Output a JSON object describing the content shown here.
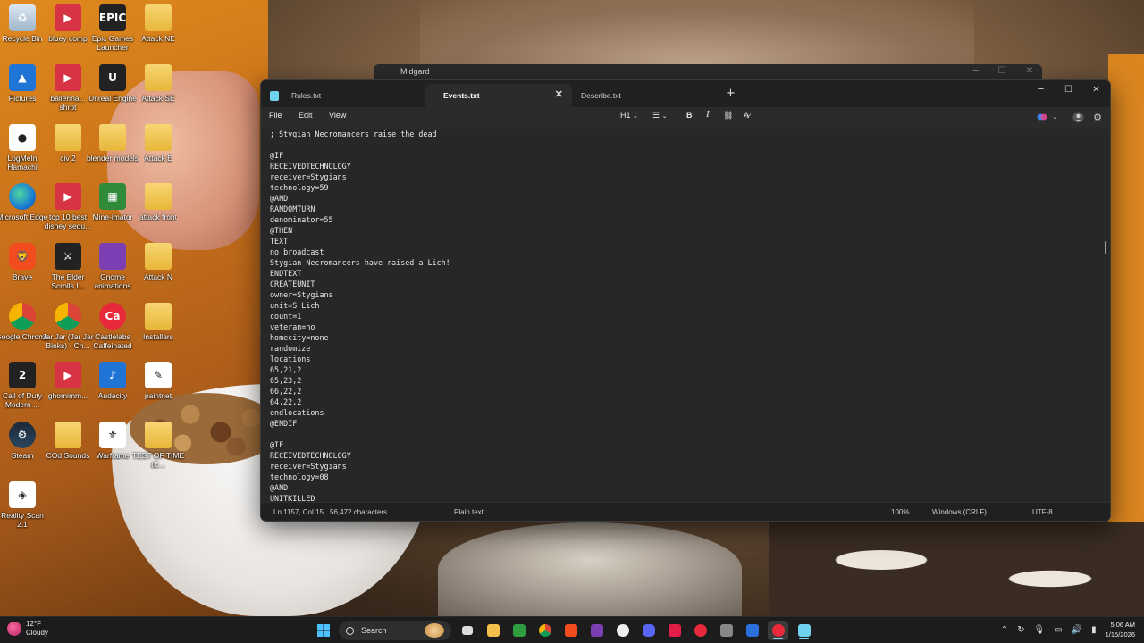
{
  "desktop": {
    "icons": [
      {
        "label": "Recycle Bin",
        "glyph": "♻",
        "style": "ic-bin"
      },
      {
        "label": "bluey comp",
        "glyph": "▶",
        "style": "ic-red"
      },
      {
        "label": "Epic Games Launcher",
        "glyph": "EPIC",
        "style": "ic-dark"
      },
      {
        "label": "Attack NE",
        "glyph": "",
        "style": "ic-folder"
      },
      {
        "label": "Pictures",
        "glyph": "▲",
        "style": "ic-blue"
      },
      {
        "label": "ballerina... shrot",
        "glyph": "▶",
        "style": "ic-red"
      },
      {
        "label": "Unreal Engine",
        "glyph": "U",
        "style": "ic-dark"
      },
      {
        "label": "Attack SE",
        "glyph": "",
        "style": "ic-folder"
      },
      {
        "label": "LogMeIn Hamachi",
        "glyph": "●",
        "style": "ic-white"
      },
      {
        "label": "civ 2",
        "glyph": "",
        "style": "ic-folder"
      },
      {
        "label": "blender models",
        "glyph": "",
        "style": "ic-folder"
      },
      {
        "label": "Attack E",
        "glyph": "",
        "style": "ic-folder"
      },
      {
        "label": "Microsoft Edge",
        "glyph": "",
        "style": "ic-edge"
      },
      {
        "label": "top 10 best disney sequ...",
        "glyph": "▶",
        "style": "ic-red"
      },
      {
        "label": "Mine-imator",
        "glyph": "▦",
        "style": "ic-green"
      },
      {
        "label": "attack front",
        "glyph": "",
        "style": "ic-folder"
      },
      {
        "label": "Brave",
        "glyph": "🦁",
        "style": "ic-brave"
      },
      {
        "label": "The Elder Scrolls I...",
        "glyph": "⚔",
        "style": "ic-dark"
      },
      {
        "label": "Gnome animations",
        "glyph": "",
        "style": "ic-purple"
      },
      {
        "label": "Attack N",
        "glyph": "",
        "style": "ic-folder"
      },
      {
        "label": "Google Chrome",
        "glyph": "",
        "style": "ic-chrome"
      },
      {
        "label": "Jar Jar (Jar Jar Binks) - Ch...",
        "glyph": "",
        "style": "ic-chrome"
      },
      {
        "label": "Castlelabs Caffeinated",
        "glyph": "Ca",
        "style": "ic-ca"
      },
      {
        "label": "Installers",
        "glyph": "",
        "style": "ic-folder"
      },
      {
        "label": "Call of Duty Modern ...",
        "glyph": "2",
        "style": "ic-dark"
      },
      {
        "label": "ghomimm...",
        "glyph": "▶",
        "style": "ic-red"
      },
      {
        "label": "Audacity",
        "glyph": "♪",
        "style": "ic-blue"
      },
      {
        "label": "paintnet",
        "glyph": "✎",
        "style": "ic-white"
      },
      {
        "label": "Steam",
        "glyph": "⚙",
        "style": "ic-steam"
      },
      {
        "label": "COd Sounds",
        "glyph": "",
        "style": "ic-folder"
      },
      {
        "label": "Warframe",
        "glyph": "⚜",
        "style": "ic-white"
      },
      {
        "label": "TEST OF TIME (E...",
        "glyph": "",
        "style": "ic-folder"
      },
      {
        "label": "Reality Scan 2.1",
        "glyph": "◈",
        "style": "ic-white"
      }
    ]
  },
  "background_window": {
    "title": "Midgard"
  },
  "notepad": {
    "tabs": [
      {
        "label": "Rules.txt",
        "active": false
      },
      {
        "label": "Events.txt",
        "active": true
      },
      {
        "label": "Describe.txt",
        "active": false
      }
    ],
    "menu": {
      "file": "File",
      "edit": "Edit",
      "view": "View"
    },
    "format": {
      "heading": "H1",
      "bold": "B",
      "italic": "I"
    },
    "lines": [
      "; Stygian Necromancers raise the dead",
      "",
      "@IF",
      "RECEIVEDTECHNOLOGY",
      "receiver=Stygians",
      "technology=59",
      "@AND",
      "RANDOMTURN",
      "denominator=55",
      "@THEN",
      "TEXT",
      "no broadcast",
      "Stygian Necromancers have raised a Lich!",
      "ENDTEXT",
      "CREATEUNIT",
      "owner=Stygians",
      "unit=S Lich",
      "count=1",
      "veteran=no",
      "homecity=none",
      "randomize",
      "locations",
      "65,21,2",
      "65,23,2",
      "66,22,2",
      "64,22,2",
      "endlocations",
      "@ENDIF",
      "",
      "@IF",
      "RECEIVEDTECHNOLOGY",
      "receiver=Stygians",
      "technology=08",
      "@AND",
      "UNITKILLED"
    ],
    "status": {
      "position": "Ln 1157, Col 15",
      "characters": "56,472 characters",
      "format": "Plain text",
      "zoom": "100%",
      "line_ending": "Windows (CRLF)",
      "encoding": "UTF-8"
    }
  },
  "taskbar": {
    "weather_temp": "12°F",
    "weather_desc": "Cloudy",
    "search_label": "Search",
    "time": "5:06 AM",
    "date": "1/15/2026"
  }
}
